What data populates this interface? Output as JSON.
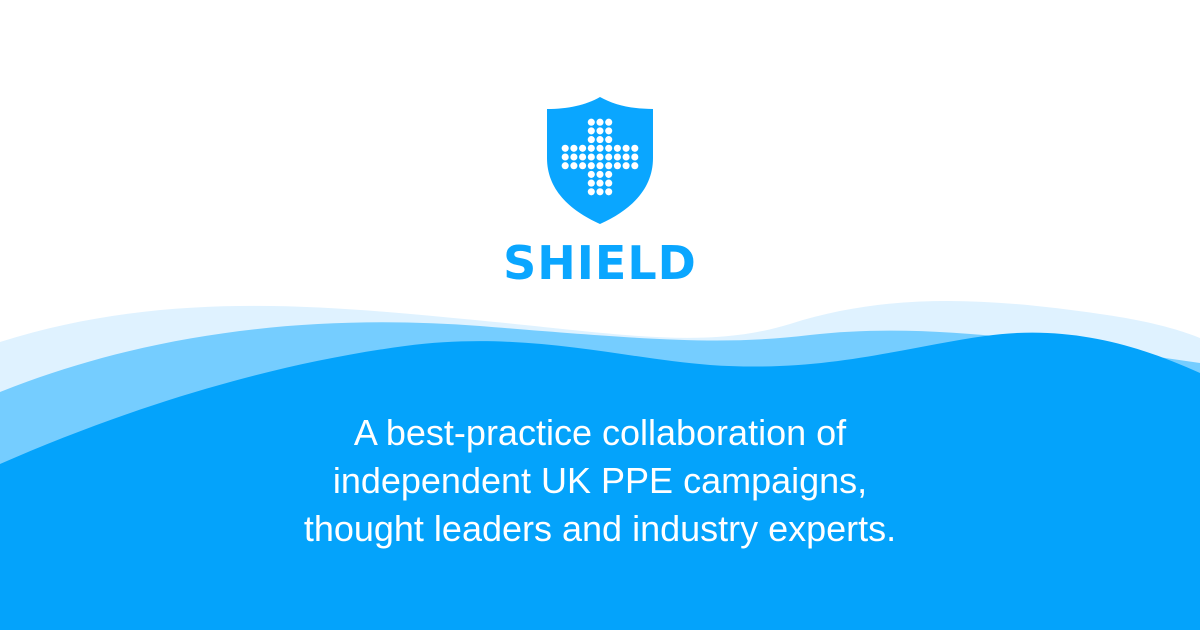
{
  "brand": {
    "name": "SHIELD",
    "logo_icon": "shield-medical-cross-icon"
  },
  "tagline": {
    "lines": [
      "A best-practice collaboration of",
      "independent UK PPE campaigns,",
      "thought leaders and industry experts."
    ]
  },
  "colors": {
    "accent": "#0aa6ff",
    "wave_primary": "#04a3fb",
    "wave_secondary": "#6fcaff",
    "wave_tertiary": "#dff2ff",
    "background": "#ffffff"
  }
}
